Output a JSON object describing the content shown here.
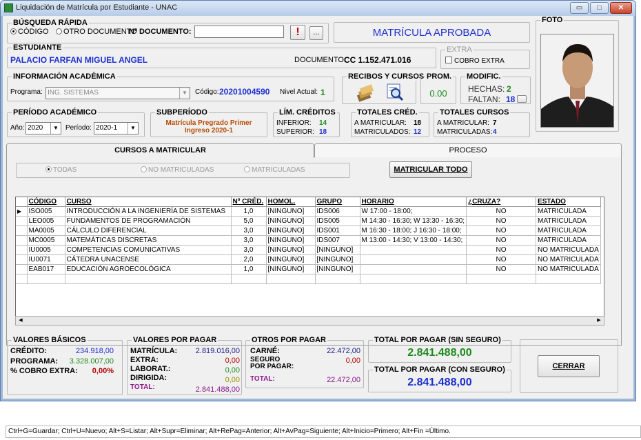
{
  "window": {
    "title": "Liquidación de Matrícula por Estudiante - UNAC",
    "min_glyph": "▭",
    "max_glyph": "□",
    "close_glyph": "✕"
  },
  "busqueda": {
    "legend": "BÚSQUEDA RÁPIDA",
    "opt_codigo": "CÓDIGO",
    "opt_otro": "OTRO DOCUMENTO",
    "doc_label": "Nº DOCUMENTO:",
    "doc_value": "",
    "alert_btn": "!",
    "more_btn": "..."
  },
  "status_banner": "MATRÍCULA APROBADA",
  "foto": {
    "legend": "FOTO"
  },
  "estudiante": {
    "legend": "ESTUDIANTE",
    "name": "PALACIO FARFAN MIGUEL ANGEL",
    "doc_label": "DOCUMENTO:",
    "doc_value": "CC 1.152.471.016"
  },
  "extra": {
    "legend": "EXTRA",
    "cobro_label": "COBRO EXTRA"
  },
  "academica": {
    "legend": "INFORMACIÓN ACADÉMICA",
    "programa_label": "Programa:",
    "programa_value": "ING. SISTEMAS",
    "codigo_label": "Código:",
    "codigo_value": "20201004590",
    "nivel_label": "Nivel Actual:",
    "nivel_value": "1"
  },
  "recibos": {
    "legend": "RECIBOS Y CURSOS"
  },
  "prom": {
    "legend": "PROM.",
    "value": "0.00"
  },
  "modific": {
    "legend": "MODIFIC.",
    "hechas_label": "HECHAS:",
    "hechas_value": "2",
    "faltan_label": "FALTAN:",
    "faltan_value": "18"
  },
  "periodo": {
    "legend": "PERÍODO ACADÉMICO",
    "anio_label": "Año:",
    "anio_value": "2020",
    "periodo_label": "Período:",
    "periodo_value": "2020-1"
  },
  "subperiodo": {
    "legend": "SUBPERÍODO",
    "line1": "Matrícula Pregrado Primer",
    "line2": "Ingreso 2020-1"
  },
  "limites": {
    "legend": "LÍM. CRÉDITOS",
    "inferior_label": "INFERIOR:",
    "inferior_value": "14",
    "superior_label": "SUPERIOR:",
    "superior_value": "18"
  },
  "totales_cred": {
    "legend": "TOTALES CRÉD.",
    "amat_label": "A MATRICULAR:",
    "amat_value": "18",
    "mat_label": "MATRICULADOS:",
    "mat_value": "12"
  },
  "totales_cursos": {
    "legend": "TOTALES CURSOS",
    "amat_label": "A MATRICULAR:",
    "amat_value": "7",
    "mat_label": "MATRICULADAS:",
    "mat_value": "4"
  },
  "tabs": {
    "tab1": "CURSOS A MATRICULAR",
    "tab2": "PROCESO"
  },
  "filtros": {
    "todas": "TODAS",
    "no_matriculadas": "NO MATRICULADAS",
    "matriculadas": "MATRICULADAS",
    "matricular_todo": "MATRICULAR TODO"
  },
  "grid": {
    "columns": [
      "CÓDIGO",
      "CURSO",
      "Nº CRÉD.",
      "HOMOL.",
      "GRUPO",
      "HORARIO",
      "¿CRUZA?",
      "ESTADO"
    ],
    "rows": [
      [
        "ISO005",
        "INTRODUCCIÓN  A LA INGENIERÍA DE SISTEMAS",
        "1,0",
        "[NINGUNO]",
        "IDS006",
        "W 17:00 - 18:00;",
        "NO",
        "MATRICULADA"
      ],
      [
        "LEO005",
        "FUNDAMENTOS DE PROGRAMACIÓN",
        "5,0",
        "[NINGUNO]",
        "IDS005",
        "M 14:30 - 16:30; W 13:30 - 16:30;",
        "NO",
        "MATRICULADA"
      ],
      [
        "MA0005",
        "CÁLCULO DIFERENCIAL",
        "3,0",
        "[NINGUNO]",
        "IDS001",
        "M 16:30 - 18:00; J 16:30 - 18:00;",
        "NO",
        "MATRICULADA"
      ],
      [
        "MC0005",
        "MATEMÁTICAS DISCRETAS",
        "3,0",
        "[NINGUNO]",
        "IDS007",
        "M 13:00 - 14:30; V 13:00 - 14:30;",
        "NO",
        "MATRICULADA"
      ],
      [
        "IU0005",
        "COMPETENCIAS COMUNICATIVAS",
        "3,0",
        "[NINGUNO]",
        "[NINGUNO]",
        "",
        "NO",
        "NO MATRICULADA"
      ],
      [
        "IU0071",
        "CÁTEDRA UNACENSE",
        "2,0",
        "[NINGUNO]",
        "[NINGUNO]",
        "",
        "NO",
        "NO MATRICULADA"
      ],
      [
        "EAB017",
        "EDUCACIÓN AGROECOLÓGICA",
        "1,0",
        "[NINGUNO]",
        "[NINGUNO]",
        "",
        "NO",
        "NO MATRICULADA"
      ]
    ]
  },
  "valores_basicos": {
    "legend": "VALORES BÁSICOS",
    "credito_label": "CRÉDITO:",
    "credito_value": "234.918,00",
    "programa_label": "PROGRAMA:",
    "programa_value": "3.328.007,00",
    "cobro_label": "% COBRO EXTRA:",
    "cobro_value": "0,00%"
  },
  "valores_pagar": {
    "legend": "VALORES POR PAGAR",
    "matricula_label": "MATRÍCULA:",
    "matricula_value": "2.819.016,00",
    "extra_label": "EXTRA:",
    "extra_value": "0,00",
    "laborat_label": "LABORAT.:",
    "laborat_value": "0,00",
    "dirigida_label": "DIRIGIDA:",
    "dirigida_value": "0,00",
    "total_label": "TOTAL:",
    "total_value": "2.841.488,00"
  },
  "otros": {
    "legend": "OTROS POR PAGAR",
    "carne_label": "CARNÉ:",
    "carne_value": "22.472,00",
    "seguro_label1": "SEGURO",
    "seguro_label2": "POR PAGAR:",
    "seguro_value": "0,00",
    "total_label": "TOTAL:",
    "total_value": "22.472,00"
  },
  "total_sin": {
    "legend": "TOTAL POR PAGAR (SIN SEGURO)",
    "value": "2.841.488,00"
  },
  "total_con": {
    "legend": "TOTAL POR PAGAR (CON SEGURO)",
    "value": "2.841.488,00"
  },
  "cerrar": "CERRAR",
  "statusbar": "Ctrl+G=Guardar; Ctrl+U=Nuevo; Alt+S=Listar; Alt+Supr=Eliminar;  Alt+RePag=Anterior; Alt+AvPag=Siguiente; Alt+Inicio=Primero; Alt+Fin =Último."
}
